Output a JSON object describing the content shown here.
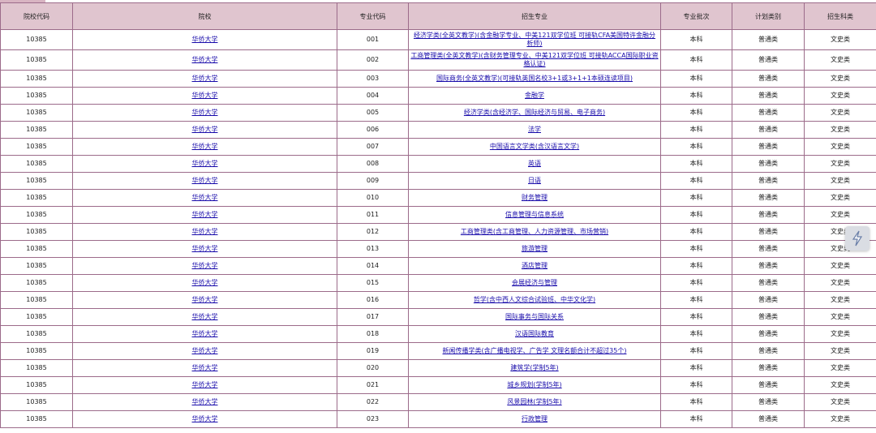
{
  "headers": [
    "院校代码",
    "院校",
    "专业代码",
    "招生专业",
    "专业批次",
    "计划类别",
    "招生科类"
  ],
  "rows": [
    {
      "school_code": "10385",
      "school": "华侨大学",
      "major_code": "001",
      "major": "经济学类(全英文教学)(含金融学专业、中美121双学位班 可接轨CFA美国特许金融分析师)",
      "batch": "本科",
      "plan": "普通类",
      "subject": "文史类"
    },
    {
      "school_code": "10385",
      "school": "华侨大学",
      "major_code": "002",
      "major": "工商管理类(全英文教学)(含财务管理专业、中美121双学位班 可接轨ACCA国际职业资格认证)",
      "batch": "本科",
      "plan": "普通类",
      "subject": "文史类"
    },
    {
      "school_code": "10385",
      "school": "华侨大学",
      "major_code": "003",
      "major": "国际商务(全英文教学)(可接轨英国名校3+1或3+1+1本硕连读项目)",
      "batch": "本科",
      "plan": "普通类",
      "subject": "文史类"
    },
    {
      "school_code": "10385",
      "school": "华侨大学",
      "major_code": "004",
      "major": "金融学",
      "batch": "本科",
      "plan": "普通类",
      "subject": "文史类"
    },
    {
      "school_code": "10385",
      "school": "华侨大学",
      "major_code": "005",
      "major": "经济学类(含经济学、国际经济与贸易、电子商务)",
      "batch": "本科",
      "plan": "普通类",
      "subject": "文史类"
    },
    {
      "school_code": "10385",
      "school": "华侨大学",
      "major_code": "006",
      "major": "法学",
      "batch": "本科",
      "plan": "普通类",
      "subject": "文史类"
    },
    {
      "school_code": "10385",
      "school": "华侨大学",
      "major_code": "007",
      "major": "中国语言文学类(含汉语言文学)",
      "batch": "本科",
      "plan": "普通类",
      "subject": "文史类"
    },
    {
      "school_code": "10385",
      "school": "华侨大学",
      "major_code": "008",
      "major": "英语",
      "batch": "本科",
      "plan": "普通类",
      "subject": "文史类"
    },
    {
      "school_code": "10385",
      "school": "华侨大学",
      "major_code": "009",
      "major": "日语",
      "batch": "本科",
      "plan": "普通类",
      "subject": "文史类"
    },
    {
      "school_code": "10385",
      "school": "华侨大学",
      "major_code": "010",
      "major": "财务管理",
      "batch": "本科",
      "plan": "普通类",
      "subject": "文史类"
    },
    {
      "school_code": "10385",
      "school": "华侨大学",
      "major_code": "011",
      "major": "信息管理与信息系统",
      "batch": "本科",
      "plan": "普通类",
      "subject": "文史类"
    },
    {
      "school_code": "10385",
      "school": "华侨大学",
      "major_code": "012",
      "major": "工商管理类(含工商管理、人力资源管理、市场营销)",
      "batch": "本科",
      "plan": "普通类",
      "subject": "文史类"
    },
    {
      "school_code": "10385",
      "school": "华侨大学",
      "major_code": "013",
      "major": "旅游管理",
      "batch": "本科",
      "plan": "普通类",
      "subject": "文史类"
    },
    {
      "school_code": "10385",
      "school": "华侨大学",
      "major_code": "014",
      "major": "酒店管理",
      "batch": "本科",
      "plan": "普通类",
      "subject": "文史类"
    },
    {
      "school_code": "10385",
      "school": "华侨大学",
      "major_code": "015",
      "major": "会展经济与管理",
      "batch": "本科",
      "plan": "普通类",
      "subject": "文史类"
    },
    {
      "school_code": "10385",
      "school": "华侨大学",
      "major_code": "016",
      "major": "哲学(含中西人文综合试验班、中华文化学)",
      "batch": "本科",
      "plan": "普通类",
      "subject": "文史类"
    },
    {
      "school_code": "10385",
      "school": "华侨大学",
      "major_code": "017",
      "major": "国际事务与国际关系",
      "batch": "本科",
      "plan": "普通类",
      "subject": "文史类"
    },
    {
      "school_code": "10385",
      "school": "华侨大学",
      "major_code": "018",
      "major": "汉语国际教育",
      "batch": "本科",
      "plan": "普通类",
      "subject": "文史类"
    },
    {
      "school_code": "10385",
      "school": "华侨大学",
      "major_code": "019",
      "major": "新闻传播学类(含广播电视学、广告学 文理名额合计不超过35个)",
      "batch": "本科",
      "plan": "普通类",
      "subject": "文史类"
    },
    {
      "school_code": "10385",
      "school": "华侨大学",
      "major_code": "020",
      "major": "建筑学(学制5年)",
      "batch": "本科",
      "plan": "普通类",
      "subject": "文史类"
    },
    {
      "school_code": "10385",
      "school": "华侨大学",
      "major_code": "021",
      "major": "城乡规划(学制5年)",
      "batch": "本科",
      "plan": "普通类",
      "subject": "文史类"
    },
    {
      "school_code": "10385",
      "school": "华侨大学",
      "major_code": "022",
      "major": "风景园林(学制5年)",
      "batch": "本科",
      "plan": "普通类",
      "subject": "文史类"
    },
    {
      "school_code": "10385",
      "school": "华侨大学",
      "major_code": "023",
      "major": "行政管理",
      "batch": "本科",
      "plan": "普通类",
      "subject": "文史类"
    }
  ],
  "floating_button": {
    "icon": "lightning-icon"
  }
}
